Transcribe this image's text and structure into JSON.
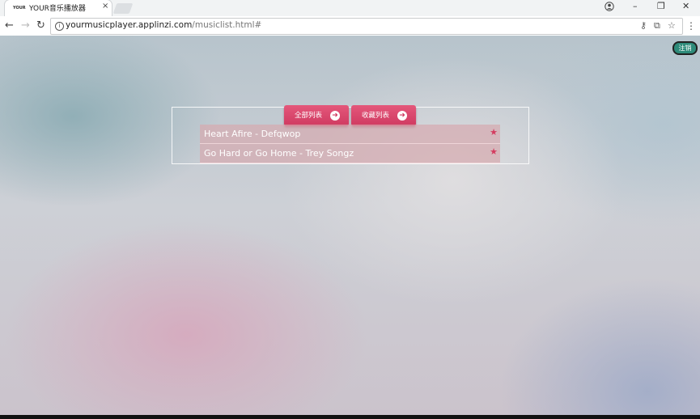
{
  "browser": {
    "tab": {
      "favicon_text": "YOUR",
      "title": "YOUR音乐播放器",
      "close_glyph": "×"
    },
    "window_controls": {
      "minimize": "–",
      "restore": "❐",
      "close": "✕"
    },
    "nav": {
      "back": "←",
      "forward": "→",
      "reload": "↻"
    },
    "url": {
      "host": "yourmusicplayer.applinzi.com",
      "path": "/musiclist.html#"
    },
    "omnibox_icons": {
      "key": "⚷",
      "translate": "⧉",
      "star": "☆",
      "menu": "⋮"
    }
  },
  "page": {
    "logout_label": "注销",
    "buttons": {
      "all_list": "全部列表",
      "favorites_list": "收藏列表",
      "arrow_glyph": "➜"
    },
    "songs": [
      {
        "title": "Heart Afire - Defqwop",
        "star": "★"
      },
      {
        "title": "Go Hard or Go Home - Trey Songz",
        "star": "★"
      }
    ]
  },
  "colors": {
    "accent": "#d43b5f",
    "logout_bg": "#2e8b7a"
  }
}
